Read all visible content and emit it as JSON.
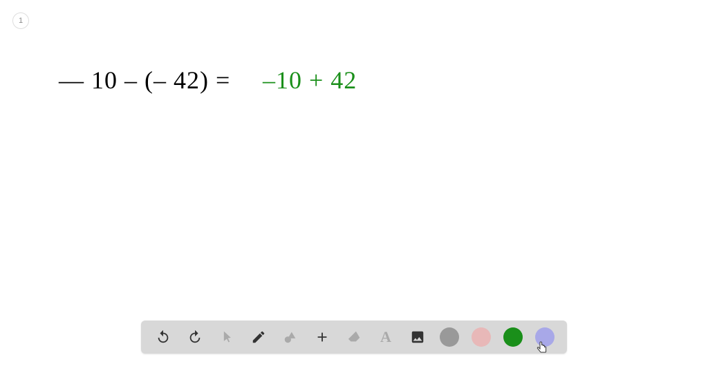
{
  "page": {
    "number": "1"
  },
  "canvas": {
    "equation_left": "— 10 – (– 42) =",
    "equation_right": "–10 + 42"
  },
  "toolbar": {
    "undo": "undo",
    "redo": "redo",
    "pointer": "pointer",
    "pen": "pen",
    "shapes": "shapes",
    "plus": "plus",
    "eraser": "eraser",
    "text": "A",
    "image": "image"
  },
  "colors": {
    "gray": "#999999",
    "pink": "#e8b8b8",
    "green": "#1a8f1a",
    "purple": "#a8a8e8"
  }
}
